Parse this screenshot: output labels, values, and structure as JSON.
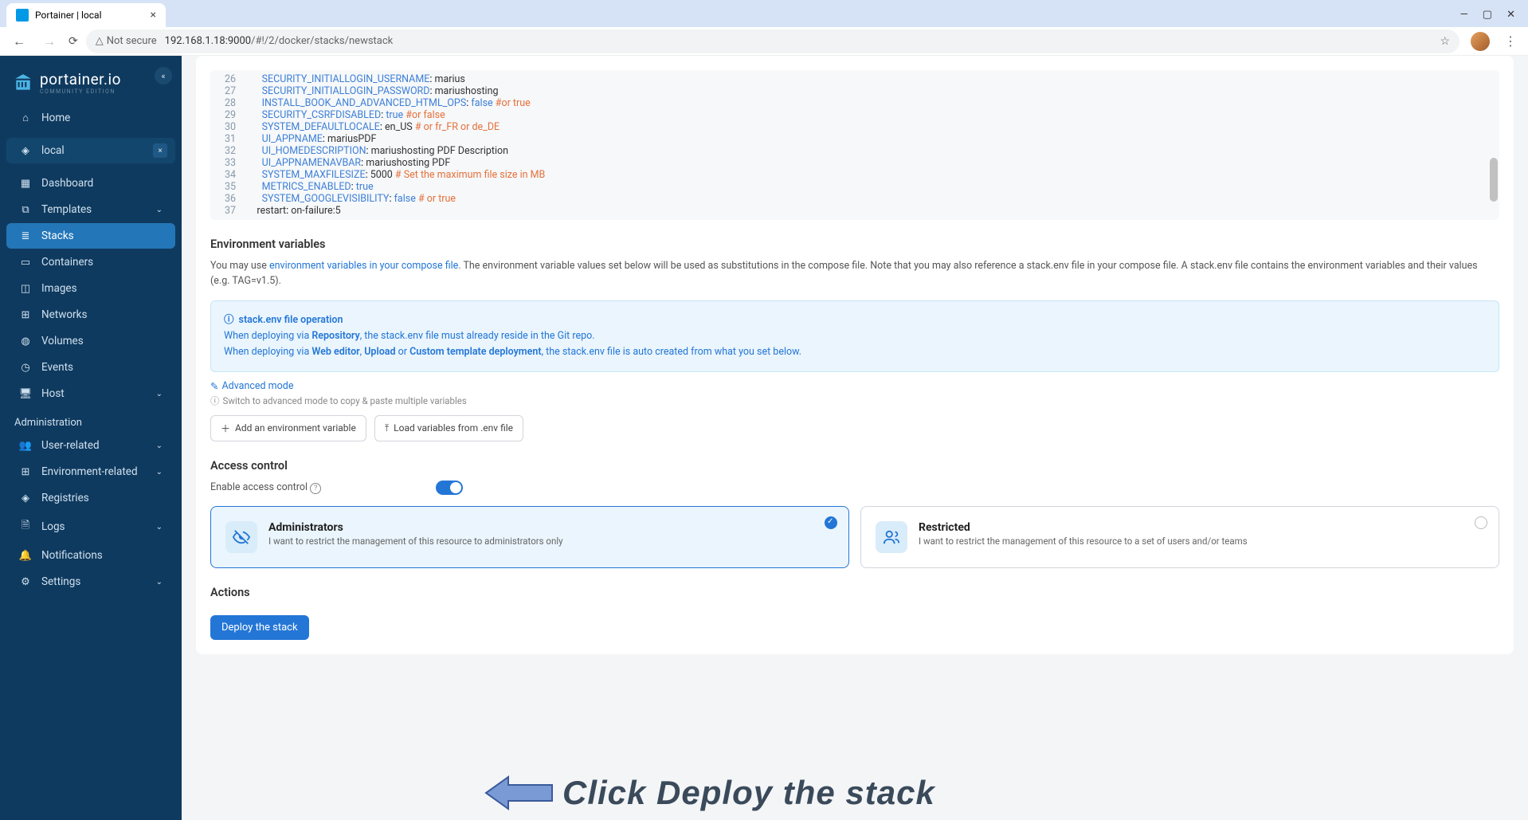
{
  "browser": {
    "tab_title": "Portainer | local",
    "not_secure": "Not secure",
    "url_host": "192.168.1.18:9000",
    "url_path": "/#!/2/docker/stacks/newstack"
  },
  "logo": {
    "name": "portainer.io",
    "edition": "COMMUNITY EDITION"
  },
  "sidebar": {
    "home": "Home",
    "env": "local",
    "items": [
      {
        "label": "Dashboard"
      },
      {
        "label": "Templates"
      },
      {
        "label": "Stacks"
      },
      {
        "label": "Containers"
      },
      {
        "label": "Images"
      },
      {
        "label": "Networks"
      },
      {
        "label": "Volumes"
      },
      {
        "label": "Events"
      },
      {
        "label": "Host"
      }
    ],
    "admin_header": "Administration",
    "admin": [
      {
        "label": "User-related"
      },
      {
        "label": "Environment-related"
      },
      {
        "label": "Registries"
      },
      {
        "label": "Logs"
      },
      {
        "label": "Notifications"
      },
      {
        "label": "Settings"
      }
    ]
  },
  "editor": {
    "lines": [
      {
        "n": 26,
        "key": "SECURITY_INITIALLOGIN_USERNAME",
        "sep": ": ",
        "val": "marius"
      },
      {
        "n": 27,
        "key": "SECURITY_INITIALLOGIN_PASSWORD",
        "sep": ": ",
        "val": "mariushosting"
      },
      {
        "n": 28,
        "key": "INSTALL_BOOK_AND_ADVANCED_HTML_OPS",
        "sep": ": ",
        "bool": "false",
        "comment": " #or true"
      },
      {
        "n": 29,
        "key": "SECURITY_CSRFDISABLED",
        "sep": ": ",
        "bool": "true",
        "comment": " #or false"
      },
      {
        "n": 30,
        "key": "SYSTEM_DEFAULTLOCALE",
        "sep": ": ",
        "val": "en_US",
        "comment": " # or fr_FR or de_DE"
      },
      {
        "n": 31,
        "key": "UI_APPNAME",
        "sep": ": ",
        "val": "mariusPDF"
      },
      {
        "n": 32,
        "key": "UI_HOMEDESCRIPTION",
        "sep": ": ",
        "val": "mariushosting PDF Description"
      },
      {
        "n": 33,
        "key": "UI_APPNAMENAVBAR",
        "sep": ": ",
        "val": "mariushosting PDF"
      },
      {
        "n": 34,
        "key": "SYSTEM_MAXFILESIZE",
        "sep": ": ",
        "num": "5000",
        "comment": " # Set the maximum file size in MB"
      },
      {
        "n": 35,
        "key": "METRICS_ENABLED",
        "sep": ": ",
        "bool": "true"
      },
      {
        "n": 36,
        "key": "SYSTEM_GOOGLEVISIBILITY",
        "sep": ": ",
        "bool": "false",
        "comment": " # or true"
      },
      {
        "n": 37,
        "restart": "restart",
        "sep": ": ",
        "val": "on-failure:5"
      }
    ]
  },
  "env_section": {
    "title": "Environment variables",
    "desc_prefix": "You may use ",
    "desc_link": "environment variables in your compose file",
    "desc_suffix": ". The environment variable values set below will be used as substitutions in the compose file. Note that you may also reference a stack.env file in your compose file. A stack.env file contains the environment variables and their values (e.g. TAG=v1.5).",
    "info_title": "stack.env file operation",
    "info_l1_a": "When deploying via ",
    "info_l1_b": "Repository",
    "info_l1_c": ", the stack.env file must already reside in the Git repo.",
    "info_l2_a": "When deploying via ",
    "info_l2_b": "Web editor",
    "info_l2_c": ", ",
    "info_l2_d": "Upload",
    "info_l2_e": " or ",
    "info_l2_f": "Custom template deployment",
    "info_l2_g": ", the stack.env file is auto created from what you set below.",
    "adv_link": "Advanced mode",
    "hint": "Switch to advanced mode to copy & paste multiple variables",
    "btn_add": "Add an environment variable",
    "btn_load": "Load variables from .env file"
  },
  "access": {
    "title": "Access control",
    "enable_label": "Enable access control",
    "admin_title": "Administrators",
    "admin_desc": "I want to restrict the management of this resource to administrators only",
    "restricted_title": "Restricted",
    "restricted_desc": "I want to restrict the management of this resource to a set of users and/or teams"
  },
  "actions": {
    "title": "Actions",
    "deploy": "Deploy the stack"
  },
  "annotation": {
    "text": "Click Deploy the stack"
  }
}
